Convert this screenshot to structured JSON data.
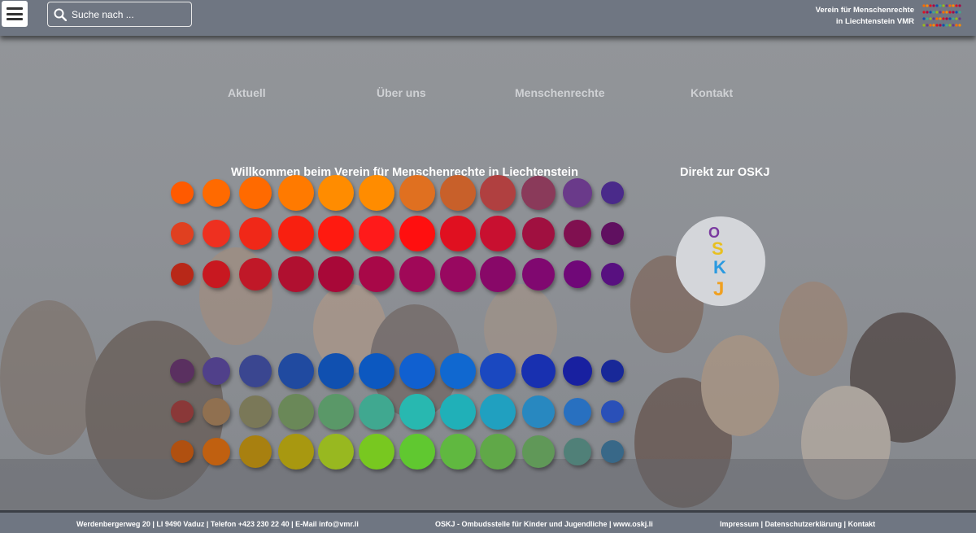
{
  "header": {
    "menu_icon": "hamburger-icon",
    "search": {
      "placeholder": "Suche nach ...",
      "icon": "search-icon"
    },
    "brand": {
      "line1": "Verein für Menschenrechte",
      "line2": "in Liechtenstein VMR"
    }
  },
  "nav": {
    "items": [
      {
        "label": "Aktuell"
      },
      {
        "label": "Über uns"
      },
      {
        "label": "Menschenrechte"
      },
      {
        "label": "Kontakt"
      }
    ]
  },
  "main": {
    "welcome": "Willkommen beim Verein für Menschenrechte in Liechtenstein",
    "direct": "Direkt zur OSKJ",
    "oskj_logo": {
      "letters": [
        "O",
        "S",
        "K",
        "J"
      ]
    }
  },
  "dots": {
    "top": [
      [
        "#ff5a00",
        "#ff6a00",
        "#ff6a00",
        "#ff7a00",
        "#ff8c00",
        "#ff8c00",
        "#e07020",
        "#c8602a",
        "#b04040",
        "#8a3a5a",
        "#6a3a8a",
        "#4a2a8a"
      ],
      [
        "#e04020",
        "#ee3020",
        "#f02818",
        "#f82010",
        "#ff1a10",
        "#ff1a1a",
        "#ff0f0f",
        "#e01020",
        "#c81030",
        "#a01040",
        "#801050",
        "#601060"
      ],
      [
        "#b82818",
        "#c81820",
        "#c01828",
        "#b01030",
        "#a80838",
        "#a80848",
        "#a00858",
        "#980860",
        "#880868",
        "#800870",
        "#700878",
        "#581080"
      ]
    ],
    "bottom": [
      [
        "#5a3060",
        "#50408a",
        "#3a4690",
        "#204aa0",
        "#1050b0",
        "#0c58c0",
        "#1060d0",
        "#1068d0",
        "#1a48c0",
        "#1830b0",
        "#1820a0",
        "#182898"
      ],
      [
        "#8a3838",
        "#907050",
        "#7a7858",
        "#6a8858",
        "#5a9868",
        "#40a890",
        "#28b8b0",
        "#20b0b8",
        "#20a0c0",
        "#2888c0",
        "#2870c0",
        "#2a50b8"
      ],
      [
        "#b05010",
        "#c06010",
        "#a88010",
        "#a89810",
        "#98b820",
        "#78c820",
        "#60c830",
        "#60b840",
        "#60a848",
        "#609858",
        "#508078",
        "#386888"
      ]
    ]
  },
  "footer": {
    "address": "Werdenbergerweg 20 | LI 9490 Vaduz | Telefon +423 230 22 40 | E-Mail info@vmr.li",
    "oskj": "OSKJ - Ombudsstelle für Kinder und Jugendliche | www.oskj.li",
    "links": "Impressum  |  Datenschutzerklärung  |  Kontakt"
  }
}
